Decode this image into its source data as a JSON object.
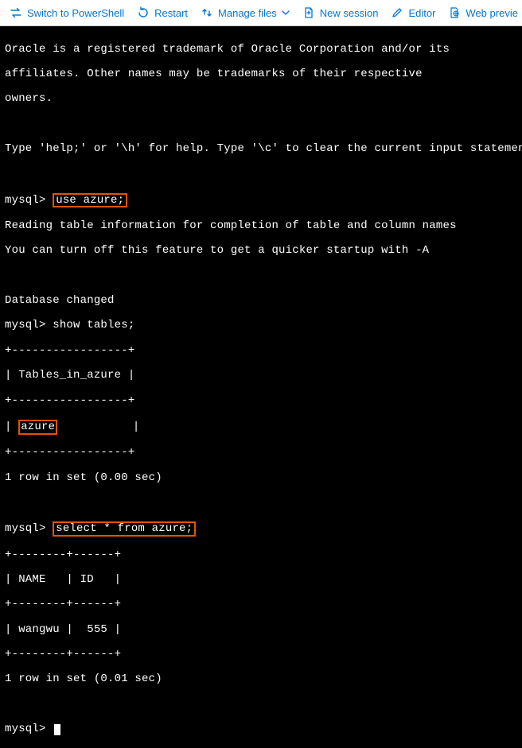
{
  "toolbar": {
    "switch_label": "Switch to PowerShell",
    "restart_label": "Restart",
    "manage_label": "Manage files",
    "new_session_label": "New session",
    "editor_label": "Editor",
    "web_preview_label": "Web previe"
  },
  "terminal": {
    "trademark_l1": "Oracle is a registered trademark of Oracle Corporation and/or its",
    "trademark_l2": "affiliates. Other names may be trademarks of their respective",
    "trademark_l3": "owners.",
    "help_line": "Type 'help;' or '\\h' for help. Type '\\c' to clear the current input statement.",
    "prompt": "mysql>",
    "cmd_use": "use azure;",
    "reading_l1": "Reading table information for completion of table and column names",
    "reading_l2": "You can turn off this feature to get a quicker startup with -A",
    "db_changed": "Database changed",
    "cmd_show_tables": "show tables;",
    "t1_sep": "+-----------------+",
    "t1_header_pre": "| ",
    "t1_header": "Tables_in_azure",
    "t1_header_post": " |",
    "t1_row_pre": "| ",
    "t1_row_val": "azure",
    "t1_row_post": "           |",
    "t1_footer": "1 row in set (0.00 sec)",
    "cmd_select": "select * from azure;",
    "t2_sep": "+--------+------+",
    "t2_header": "| NAME   | ID   |",
    "t2_row": "| wangwu |  555 |",
    "t2_footer": "1 row in set (0.01 sec)"
  },
  "chart_data": [
    {
      "type": "table",
      "title": "show tables",
      "columns": [
        "Tables_in_azure"
      ],
      "rows": [
        [
          "azure"
        ]
      ],
      "footer": "1 row in set (0.00 sec)"
    },
    {
      "type": "table",
      "title": "select * from azure",
      "columns": [
        "NAME",
        "ID"
      ],
      "rows": [
        [
          "wangwu",
          555
        ]
      ],
      "footer": "1 row in set (0.01 sec)"
    }
  ]
}
